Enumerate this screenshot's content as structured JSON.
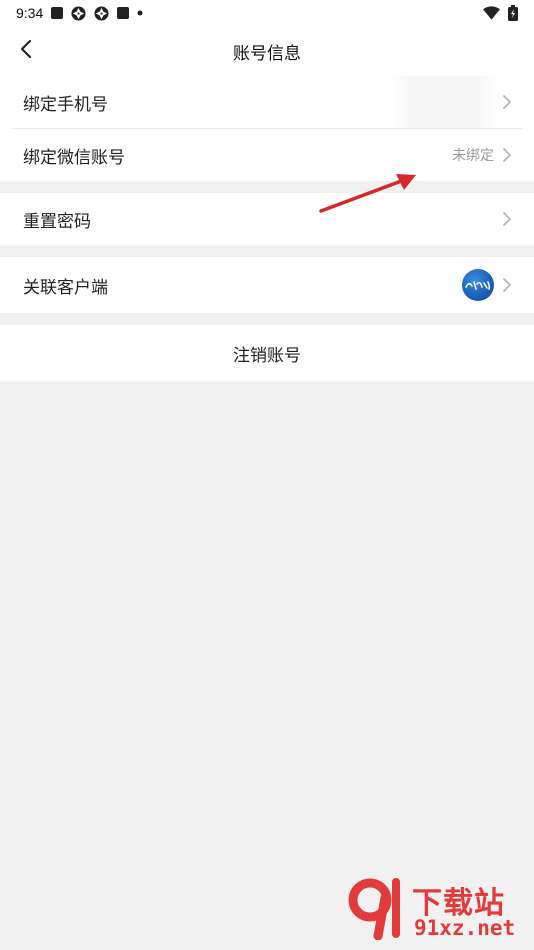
{
  "status_bar": {
    "time": "9:34"
  },
  "header": {
    "title": "账号信息"
  },
  "rows": {
    "bind_phone": {
      "label": "绑定手机号"
    },
    "bind_wechat": {
      "label": "绑定微信账号",
      "value": "未绑定"
    },
    "reset_password": {
      "label": "重置密码"
    },
    "linked_client": {
      "label": "关联客户端"
    }
  },
  "cancel_account": {
    "label": "注销账号"
  },
  "watermark": {
    "brand": "下载站",
    "url": "91xz.net"
  },
  "colors": {
    "background": "#f1f1f1",
    "card": "#ffffff",
    "annotation_arrow": "#d62828",
    "watermark": "#e23b3b",
    "logo_blue": "#1a62b8"
  }
}
